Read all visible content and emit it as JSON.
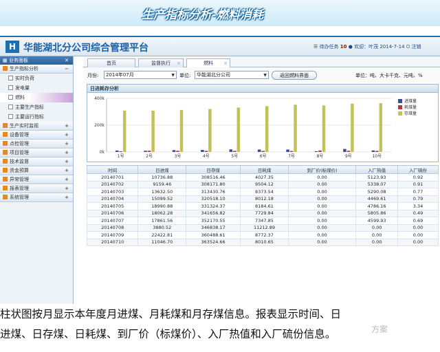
{
  "slide": {
    "title": "生产指标分析-燃料消耗",
    "caption_line1": "柱状图按月显示本年度月进煤、月耗煤和月存煤信息。报表显示时间、日",
    "caption_line2": "进煤、日存煤、日耗煤、到厂价（标煤价）、入厂热值和入厂硫份信息。",
    "watermark": "方案"
  },
  "app": {
    "logo": "H",
    "title": "华能湖北分公司综合管理平台",
    "todo_label": "待办任务",
    "todo_count": "10",
    "welcome": "欢迎：叶茂",
    "date": "2014-7-14",
    "logout": "注销"
  },
  "nav": {
    "header": "业务面板",
    "close": "✕",
    "groups": [
      {
        "label": "生产指标分析",
        "pm": "−"
      },
      {
        "label": "生产实时监视",
        "pm": "+"
      },
      {
        "label": "设备管理",
        "pm": "+"
      },
      {
        "label": "点检管理",
        "pm": "+"
      },
      {
        "label": "项目管理",
        "pm": "+"
      },
      {
        "label": "技术监督",
        "pm": "+"
      },
      {
        "label": "资金预算",
        "pm": "+"
      },
      {
        "label": "异常管理",
        "pm": "+"
      },
      {
        "label": "报表管理",
        "pm": "+"
      },
      {
        "label": "系统管理",
        "pm": "+"
      }
    ],
    "subitems": [
      "实时负荷",
      "发电量",
      "燃料",
      "主要生产指标",
      "主要运行指标"
    ]
  },
  "tabs": [
    {
      "label": "首页"
    },
    {
      "label": "监督执行"
    },
    {
      "label": "燃料"
    }
  ],
  "filter": {
    "month_label": "月份:",
    "month_value": "2014年07月",
    "unit_label": "单位:",
    "unit_value": "华能湖北分公司",
    "return_button": "返回燃料界面",
    "units_note": "单位：吨、大卡千克、元吨、%"
  },
  "chart_panel": {
    "title": "日进耗存分析"
  },
  "chart_data": {
    "type": "bar",
    "title": "日进耗存分析",
    "categories": [
      "1号",
      "2号",
      "3号",
      "4号",
      "5号",
      "6号",
      "7号",
      "8号",
      "9号",
      "10号"
    ],
    "yticks": [
      "400k",
      "200k",
      "0k"
    ],
    "ylim": [
      0,
      400000
    ],
    "legend_position": "right",
    "series": [
      {
        "name": "进煤量",
        "color": "#3d4b9a",
        "values": [
          10736.88,
          9159.46,
          13632.5,
          15099.52,
          18990.88,
          18062.28,
          17861.56,
          3880.52,
          22422.81,
          11046.7
        ]
      },
      {
        "name": "耗煤量",
        "color": "#b23a3a",
        "values": [
          4027.35,
          9504.12,
          8373.54,
          8012.18,
          8184.61,
          7729.84,
          7347.85,
          11212.89,
          8772.37,
          8010.65
        ]
      },
      {
        "name": "存煤量",
        "color": "#c2c25a",
        "values": [
          308516.46,
          308171.8,
          313430.76,
          320518.1,
          331324.37,
          341656.82,
          352170.55,
          346838.17,
          360488.61,
          363524.66
        ]
      }
    ]
  },
  "table": {
    "headers": [
      "时间",
      "日进煤",
      "日存煤",
      "日耗煤",
      "到厂价(标煤价)",
      "入厂热值",
      "入厂硫份"
    ],
    "rows": [
      [
        "20140701",
        "10736.88",
        "308516.46",
        "4027.35",
        "0.00",
        "5123.93",
        "0.92"
      ],
      [
        "20140702",
        "9159.46",
        "308171.80",
        "9504.12",
        "0.00",
        "5338.07",
        "0.91"
      ],
      [
        "20140703",
        "13632.50",
        "313430.76",
        "8373.54",
        "0.00",
        "5290.08",
        "0.77"
      ],
      [
        "20140704",
        "15099.52",
        "320518.10",
        "8012.18",
        "0.00",
        "4469.61",
        "0.79"
      ],
      [
        "20140705",
        "18990.88",
        "331324.37",
        "8184.61",
        "0.00",
        "4786.16",
        "3.34"
      ],
      [
        "20140706",
        "18062.28",
        "341656.82",
        "7729.84",
        "0.00",
        "5805.86",
        "0.49"
      ],
      [
        "20140707",
        "17861.56",
        "352170.55",
        "7347.85",
        "0.00",
        "4599.93",
        "0.69"
      ],
      [
        "20140708",
        "3880.52",
        "346838.17",
        "11212.89",
        "0.00",
        "0.00",
        "0.00"
      ],
      [
        "20140709",
        "22422.81",
        "360488.61",
        "8772.37",
        "0.00",
        "0.00",
        "0.00"
      ],
      [
        "20140710",
        "11046.70",
        "363524.66",
        "8010.65",
        "0.00",
        "0.00",
        "0.00"
      ]
    ]
  }
}
